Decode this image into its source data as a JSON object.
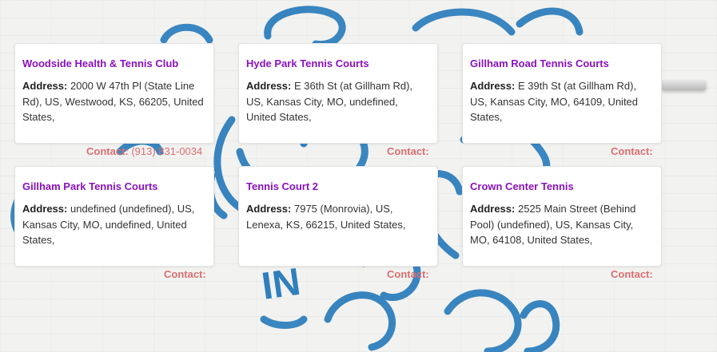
{
  "clubs": [
    {
      "name": "Woodside Health & Tennis Club",
      "address_label": "Address:",
      "address": "2000 W 47th Pl (State Line Rd), US, Westwood, KS, 66205, United States,",
      "contact_label": "Contact:",
      "phone": "(913) 831-0034"
    },
    {
      "name": "Hyde Park Tennis Courts",
      "address_label": "Address:",
      "address": "E 36th St (at Gillham Rd), US, Kansas City, MO, undefined, United States,",
      "contact_label": "Contact:",
      "phone": ""
    },
    {
      "name": "Gillham Road Tennis Courts",
      "address_label": "Address:",
      "address": "E 39th St (at Gillham Rd), US, Kansas City, MO, 64109, United States,",
      "contact_label": "Contact:",
      "phone": ""
    },
    {
      "name": "Gillham Park Tennis Courts",
      "address_label": "Address:",
      "address": "undefined (undefined), US, Kansas City, MO, undefined, United States,",
      "contact_label": "Contact:",
      "phone": ""
    },
    {
      "name": "Tennis Court 2",
      "address_label": "Address:",
      "address": "7975 (Monrovia), US, Lenexa, KS, 66215, United States,",
      "contact_label": "Contact:",
      "phone": ""
    },
    {
      "name": "Crown Center Tennis",
      "address_label": "Address:",
      "address": "2525 Main Street (Behind Pool) (undefined), US, Kansas City, MO, 64108, United States,",
      "contact_label": "Contact:",
      "phone": ""
    }
  ],
  "background": {
    "mural_text": "IN",
    "mural_color": "#2f7fbd"
  }
}
